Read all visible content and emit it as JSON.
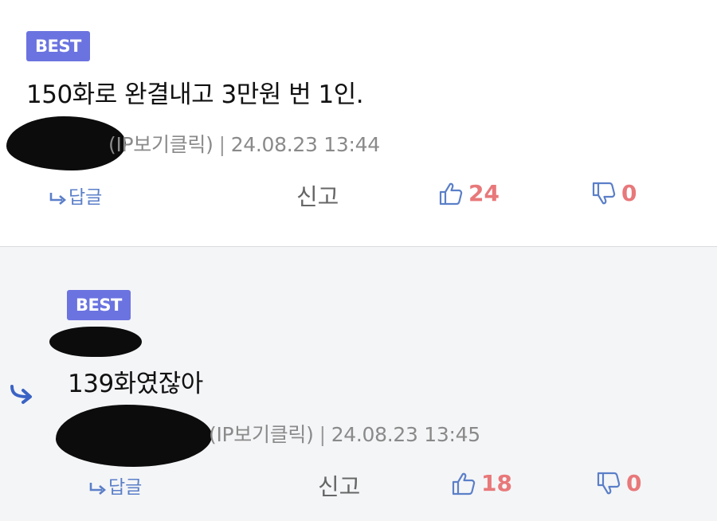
{
  "comments": [
    {
      "badge": "BEST",
      "text": "150화로 완결내고 3만원 번 1인.",
      "ip_label": "(IP보기클릭)",
      "separator": "|",
      "timestamp": "24.08.23 13:44",
      "reply_label": "답글",
      "report_label": "신고",
      "likes": "24",
      "dislikes": "0"
    },
    {
      "badge": "BEST",
      "text": "139화였잖아",
      "ip_label": "(IP보기클릭)",
      "separator": "|",
      "timestamp": "24.08.23 13:45",
      "reply_label": "답글",
      "report_label": "신고",
      "likes": "18",
      "dislikes": "0"
    }
  ],
  "colors": {
    "badge": "#6b73e0",
    "like_count": "#e8787a",
    "icon_blue": "#5b7fc8",
    "reply_bg": "#f4f5f7"
  }
}
